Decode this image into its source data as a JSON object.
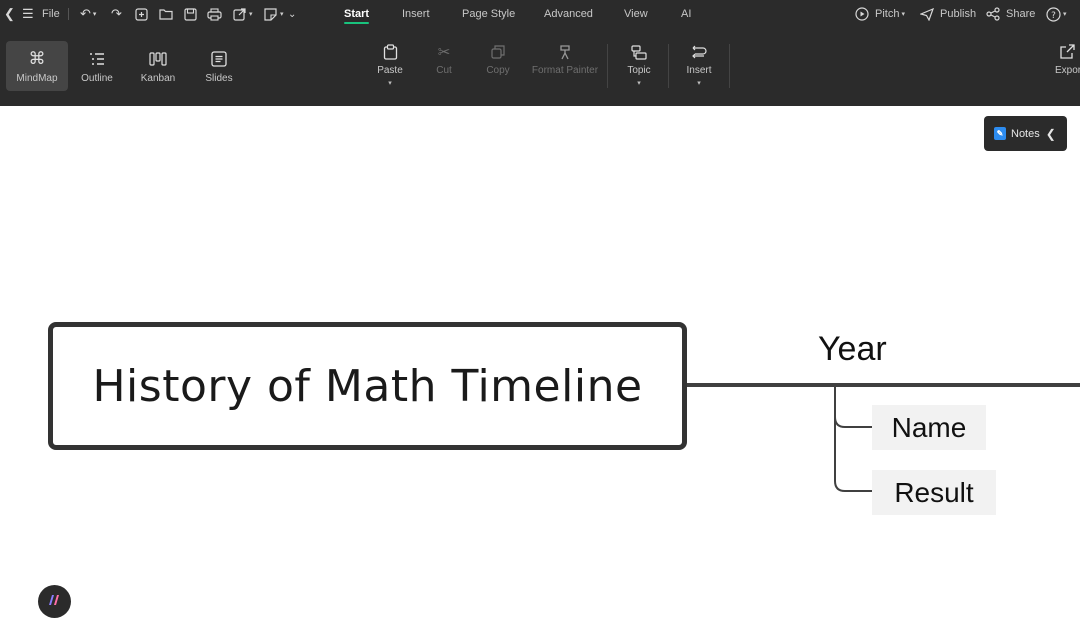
{
  "topbar": {
    "file_label": "File",
    "tabs": [
      {
        "label": "Start",
        "active": true
      },
      {
        "label": "Insert",
        "active": false
      },
      {
        "label": "Page Style",
        "active": false
      },
      {
        "label": "Advanced",
        "active": false
      },
      {
        "label": "View",
        "active": false
      },
      {
        "label": "AI",
        "active": false
      }
    ],
    "pitch_label": "Pitch",
    "publish_label": "Publish",
    "share_label": "Share"
  },
  "views": [
    {
      "label": "MindMap",
      "icon": "mindmap-icon",
      "active": true
    },
    {
      "label": "Outline",
      "icon": "outline-icon",
      "active": false
    },
    {
      "label": "Kanban",
      "icon": "kanban-icon",
      "active": false
    },
    {
      "label": "Slides",
      "icon": "slides-icon",
      "active": false
    }
  ],
  "tools": [
    {
      "label": "Paste",
      "icon": "paste-icon",
      "enabled": true
    },
    {
      "label": "Cut",
      "icon": "cut-icon",
      "enabled": false
    },
    {
      "label": "Copy",
      "icon": "copy-icon",
      "enabled": false
    },
    {
      "label": "Format Painter",
      "icon": "format-painter-icon",
      "enabled": false
    },
    {
      "label": "Topic",
      "icon": "topic-icon",
      "enabled": true
    },
    {
      "label": "Insert",
      "icon": "insert-icon",
      "enabled": true
    },
    {
      "label": "Expor",
      "icon": "export-icon",
      "enabled": true
    }
  ],
  "notes": {
    "label": "Notes"
  },
  "mindmap": {
    "central_topic": "History of Math Timeline",
    "main_topic": "Year",
    "subtopics": [
      "Name",
      "Result"
    ]
  },
  "colors": {
    "toolbar_bg": "#2b2b2b",
    "accent": "#19c37d",
    "notes_badge": "#2d8cf0",
    "line": "#404040"
  }
}
